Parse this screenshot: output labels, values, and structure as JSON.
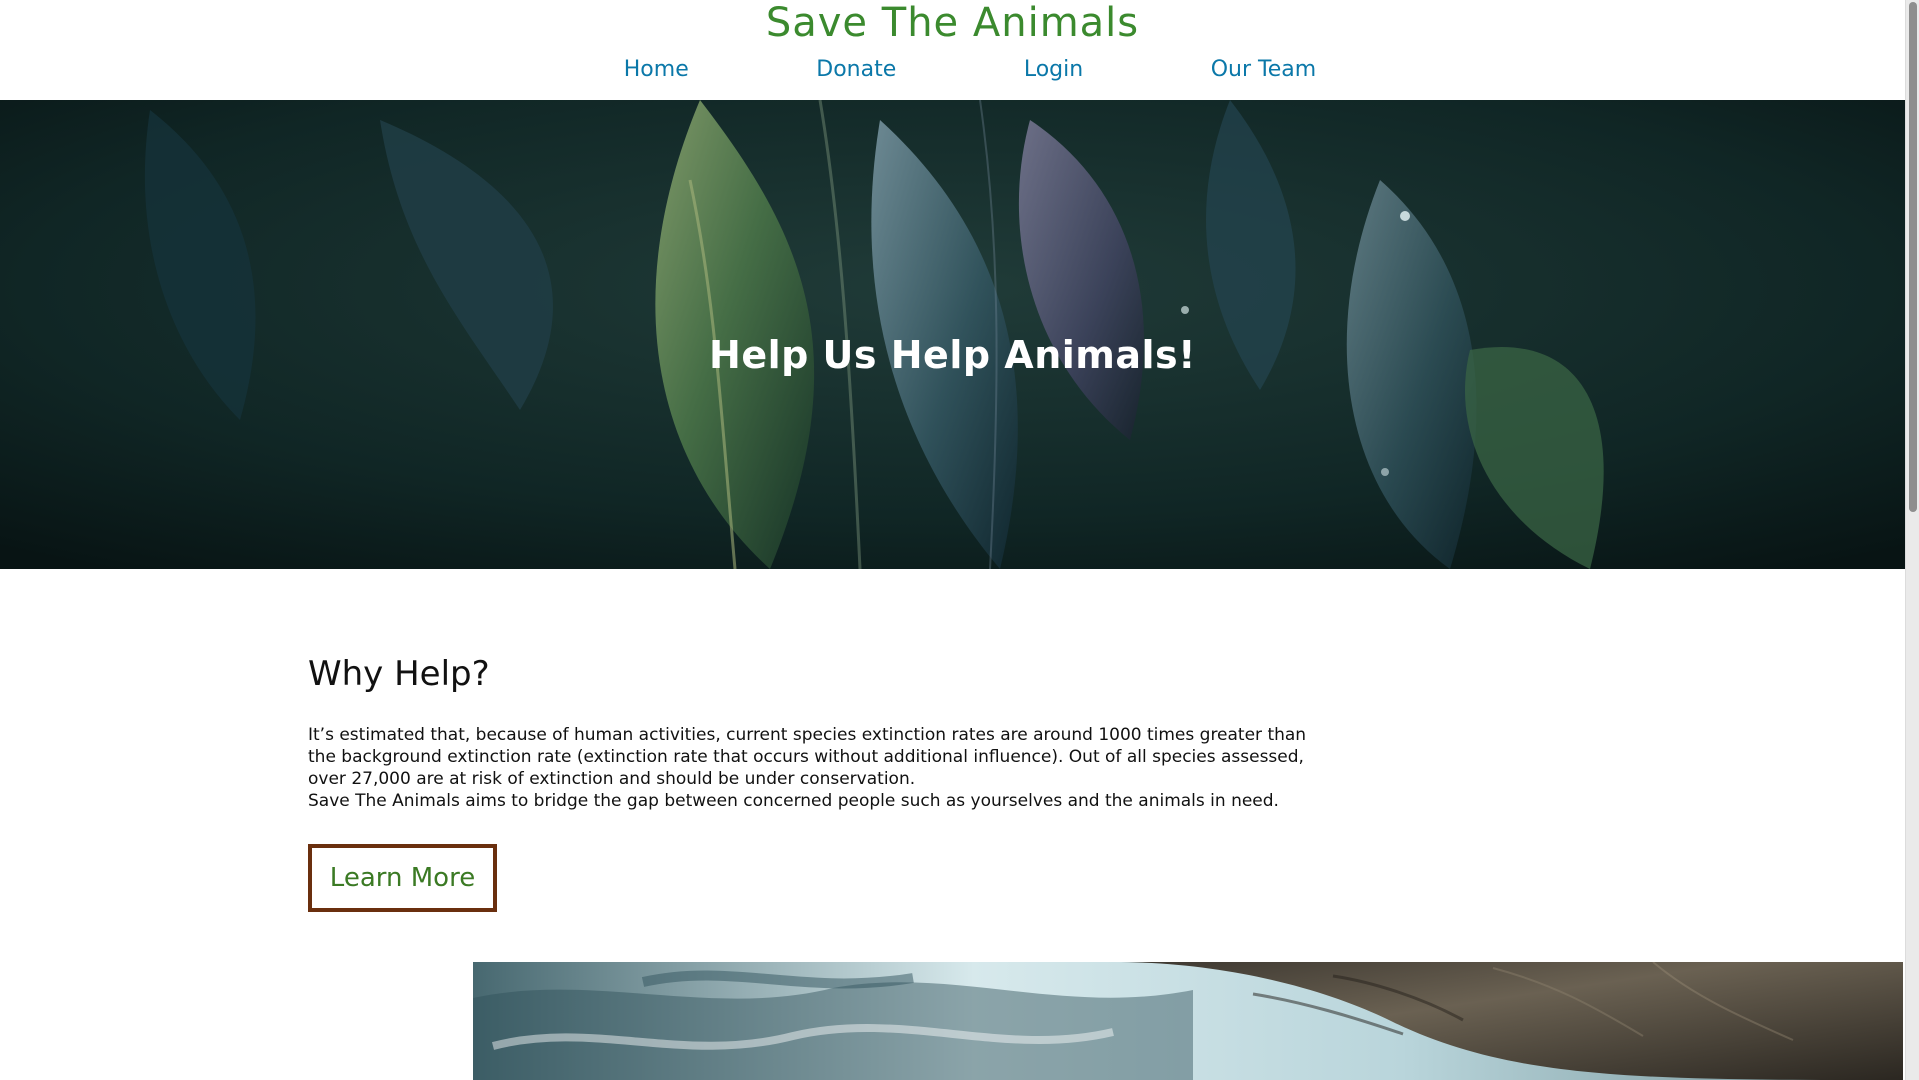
{
  "header": {
    "site_title": "Save The Animals",
    "nav": [
      {
        "label": "Home"
      },
      {
        "label": "Donate"
      },
      {
        "label": "Login"
      },
      {
        "label": "Our Team"
      }
    ]
  },
  "hero": {
    "heading": "Help Us Help Animals!"
  },
  "why": {
    "title": "Why Help?",
    "paragraph_1": "It’s estimated that, because of human activities, current species extinction rates are around 1000 times greater than the background extinction rate (extinction rate that occurs without additional influence). Out of all species assessed, over 27,000 are at risk of extinction and should be under conservation.",
    "paragraph_2": "Save The Animals aims to bridge the gap between concerned people such as yourselves and the animals in need.",
    "button_label": "Learn More"
  },
  "colors": {
    "title_green": "#3b8a2e",
    "nav_blue": "#0b78a9",
    "button_border": "#6a2f0e",
    "button_text": "#3b7a24"
  }
}
